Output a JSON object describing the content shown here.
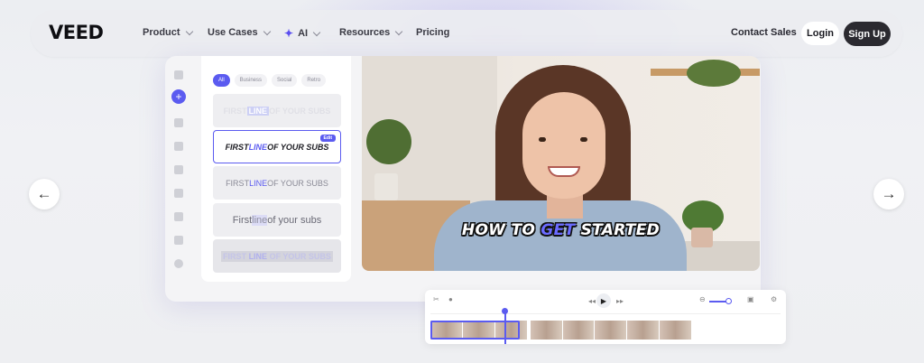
{
  "brand": {
    "logo": "VEED"
  },
  "nav": {
    "items": [
      {
        "label": "Product",
        "has_dropdown": true
      },
      {
        "label": "Use Cases",
        "has_dropdown": true
      },
      {
        "label": "AI",
        "has_dropdown": true,
        "icon": "sparkle-icon"
      },
      {
        "label": "Resources",
        "has_dropdown": true
      },
      {
        "label": "Pricing",
        "has_dropdown": false
      }
    ],
    "contact_sales": "Contact Sales",
    "login": "Login",
    "signup": "Sign Up"
  },
  "carousel": {
    "prev_icon": "arrow-left-icon",
    "next_icon": "arrow-right-icon"
  },
  "editor": {
    "filter_chips": [
      "All",
      "Business",
      "Social",
      "Retro"
    ],
    "selected_chip": "All",
    "subtitle_styles": [
      {
        "text_before": "FIRST ",
        "highlight": "LINE",
        "text_after": " OF YOUR SUBS",
        "variant": "boxed"
      },
      {
        "text_before": "FIRST ",
        "highlight": "LINE",
        "text_after": " OF YOUR SUBS",
        "variant": "bold-italic",
        "selected": true,
        "tag": "Edit"
      },
      {
        "text_before": "FIRST ",
        "highlight": "LINE",
        "text_after": " OF YOUR SUBS",
        "variant": "plain"
      },
      {
        "text_before": "First ",
        "highlight": "line",
        "text_after": " of your subs",
        "variant": "sentence"
      },
      {
        "text_before": "FIRST ",
        "highlight": "LINE",
        "text_after": " OF YOUR SUBS",
        "variant": "retro"
      }
    ],
    "video_caption": {
      "before": "HOW TO ",
      "highlight": "GET",
      "after": " STARTED"
    }
  },
  "colors": {
    "accent": "#5b5bf0",
    "signup_bg": "#2b2a30"
  }
}
